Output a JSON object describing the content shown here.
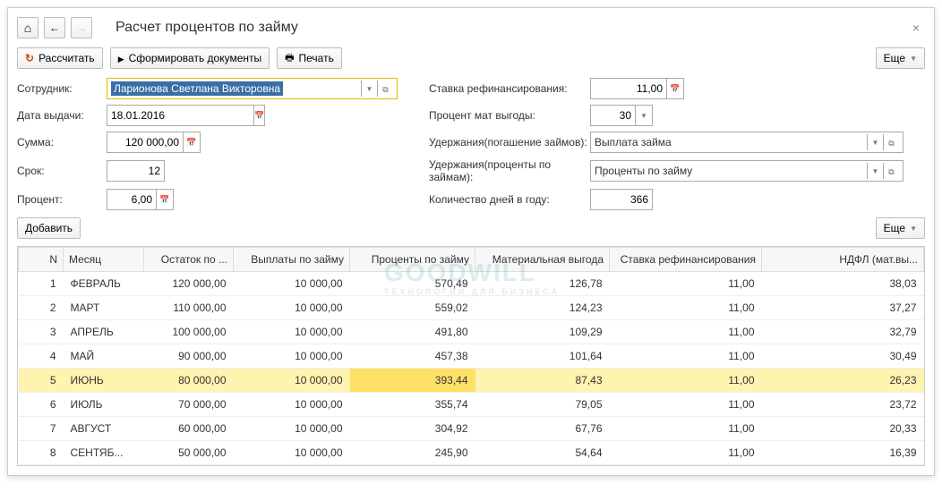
{
  "title": "Расчет процентов по займу",
  "toolbar": {
    "calc": "Рассчитать",
    "form_docs": "Сформировать документы",
    "print": "Печать",
    "more": "Еще"
  },
  "form": {
    "employee_label": "Сотрудник:",
    "employee_value": "Ларионова Светлана Викторовна",
    "date_label": "Дата выдачи:",
    "date_value": "18.01.2016",
    "sum_label": "Сумма:",
    "sum_value": "120 000,00",
    "term_label": "Срок:",
    "term_value": "12",
    "percent_label": "Процент:",
    "percent_value": "6,00",
    "refin_label": "Ставка рефинансирования:",
    "refin_value": "11,00",
    "matv_label": "Процент мат выгоды:",
    "matv_value": "30",
    "ded_repay_label": "Удержания(погашение займов):",
    "ded_repay_value": "Выплата займа",
    "ded_int_label": "Удержания(проценты по займам):",
    "ded_int_value": "Проценты по займу",
    "days_label": "Количество дней в году:",
    "days_value": "366",
    "add": "Добавить"
  },
  "headers": {
    "n": "N",
    "month": "Месяц",
    "balance": "Остаток по ...",
    "payment": "Выплаты по займу",
    "interest": "Проценты по займу",
    "benefit": "Материальная выгода",
    "refin": "Ставка рефинансирования",
    "ndfl": "НДФЛ (мат.вы..."
  },
  "rows": [
    {
      "n": "1",
      "month": "ФЕВРАЛЬ",
      "balance": "120 000,00",
      "payment": "10 000,00",
      "interest": "570,49",
      "benefit": "126,78",
      "refin": "11,00",
      "ndfl": "38,03"
    },
    {
      "n": "2",
      "month": "МАРТ",
      "balance": "110 000,00",
      "payment": "10 000,00",
      "interest": "559,02",
      "benefit": "124,23",
      "refin": "11,00",
      "ndfl": "37,27"
    },
    {
      "n": "3",
      "month": "АПРЕЛЬ",
      "balance": "100 000,00",
      "payment": "10 000,00",
      "interest": "491,80",
      "benefit": "109,29",
      "refin": "11,00",
      "ndfl": "32,79"
    },
    {
      "n": "4",
      "month": "МАЙ",
      "balance": "90 000,00",
      "payment": "10 000,00",
      "interest": "457,38",
      "benefit": "101,64",
      "refin": "11,00",
      "ndfl": "30,49"
    },
    {
      "n": "5",
      "month": "ИЮНЬ",
      "balance": "80 000,00",
      "payment": "10 000,00",
      "interest": "393,44",
      "benefit": "87,43",
      "refin": "11,00",
      "ndfl": "26,23",
      "selected": true
    },
    {
      "n": "6",
      "month": "ИЮЛЬ",
      "balance": "70 000,00",
      "payment": "10 000,00",
      "interest": "355,74",
      "benefit": "79,05",
      "refin": "11,00",
      "ndfl": "23,72"
    },
    {
      "n": "7",
      "month": "АВГУСТ",
      "balance": "60 000,00",
      "payment": "10 000,00",
      "interest": "304,92",
      "benefit": "67,76",
      "refin": "11,00",
      "ndfl": "20,33"
    },
    {
      "n": "8",
      "month": "СЕНТЯБ...",
      "balance": "50 000,00",
      "payment": "10 000,00",
      "interest": "245,90",
      "benefit": "54,64",
      "refin": "11,00",
      "ndfl": "16,39"
    }
  ]
}
